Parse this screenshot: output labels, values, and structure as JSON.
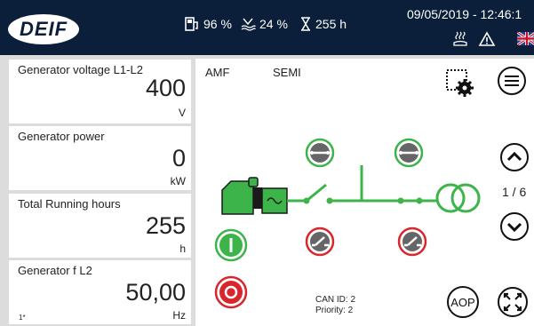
{
  "header": {
    "logo_text": "DEIF",
    "fuel": "96 %",
    "def_level": "24 %",
    "running_hours": "255 h",
    "datetime": "09/05/2019 - 12:46:1",
    "icons": [
      "fuel-icon",
      "def-icon",
      "hourglass-icon",
      "heater-icon",
      "warning-icon",
      "uk-flag-icon"
    ]
  },
  "panels": [
    {
      "label": "Generator voltage L1-L2",
      "value": "400",
      "unit": "V",
      "foot": ""
    },
    {
      "label": "Generator power",
      "value": "0",
      "unit": "kW",
      "foot": ""
    },
    {
      "label": "Total Running hours",
      "value": "255",
      "unit": "h",
      "foot": ""
    },
    {
      "label": "Generator f L2",
      "value": "50,00",
      "unit": "Hz",
      "foot": "1*"
    }
  ],
  "main": {
    "mode_left": "AMF",
    "mode_right": "SEMI",
    "page": "1 / 6",
    "can_id": "CAN ID: 2",
    "priority": "Priority: 2",
    "aop_label": "AOP"
  },
  "colors": {
    "navy": "#0b1f3a",
    "green": "#3cb44a",
    "red": "#d8262c",
    "grey": "#666666"
  }
}
